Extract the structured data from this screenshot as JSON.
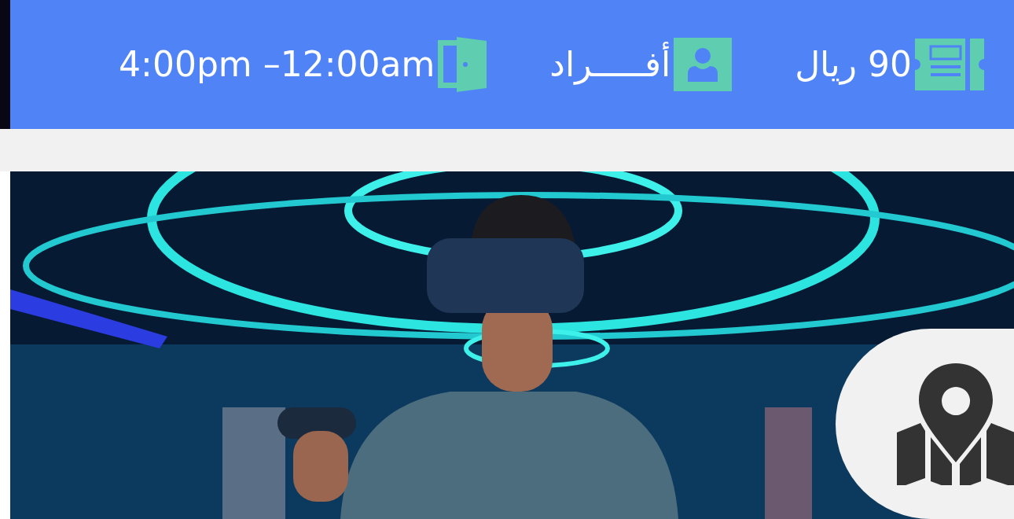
{
  "info_bar": {
    "items": [
      {
        "kind": "price",
        "text": "90 ريال"
      },
      {
        "kind": "people",
        "text": "أفـــــراد"
      },
      {
        "kind": "hours",
        "text": "4:00pm –12:00am"
      }
    ]
  }
}
